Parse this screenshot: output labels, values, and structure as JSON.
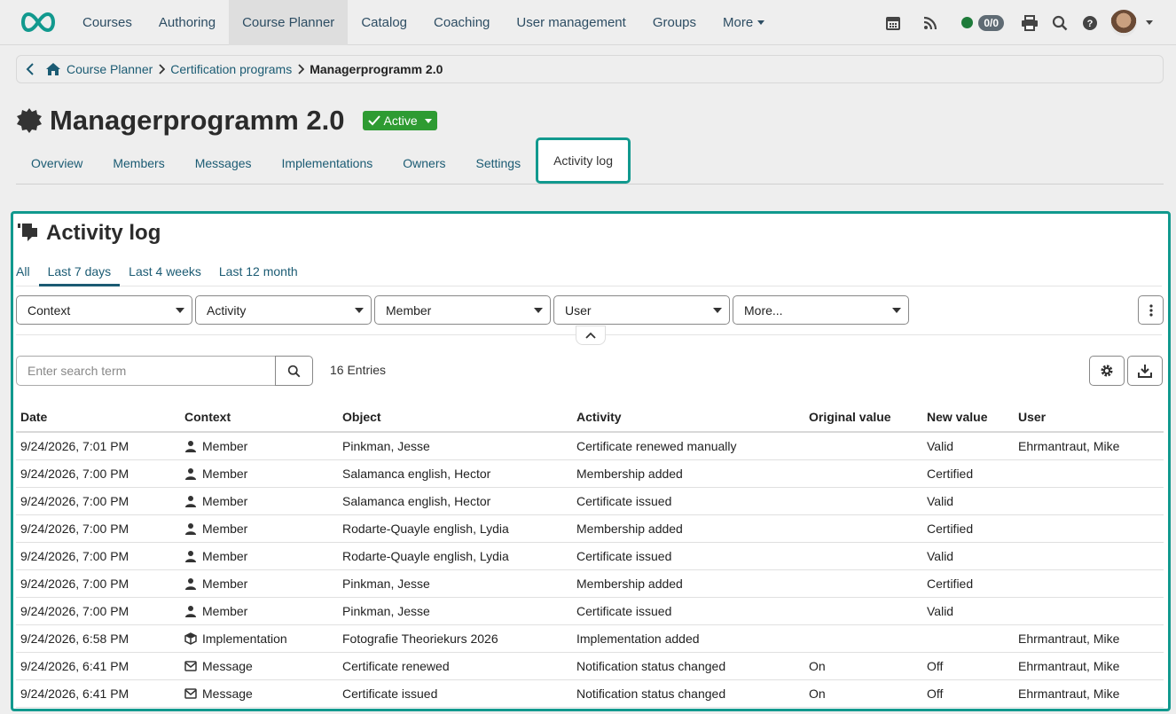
{
  "nav": {
    "items": [
      "Courses",
      "Authoring",
      "Course Planner",
      "Catalog",
      "Coaching",
      "User management",
      "Groups"
    ],
    "more": "More",
    "badge": "0/0",
    "logo_color": "#11998e"
  },
  "breadcrumb": {
    "home": "Course Planner",
    "parent": "Certification programs",
    "current": "Managerprogramm 2.0"
  },
  "page": {
    "title": "Managerprogramm 2.0",
    "status": "Active"
  },
  "tabs": [
    "Overview",
    "Members",
    "Messages",
    "Implementations",
    "Owners",
    "Settings",
    "Activity log"
  ],
  "panel": {
    "title": "Activity log",
    "subtabs": [
      "All",
      "Last 7 days",
      "Last 4 weeks",
      "Last 12 month"
    ],
    "filters": [
      "Context",
      "Activity",
      "Member",
      "User",
      "More..."
    ],
    "search_placeholder": "Enter search term",
    "entries": "16 Entries"
  },
  "table": {
    "headers": [
      "Date",
      "Context",
      "Object",
      "Activity",
      "Original value",
      "New value",
      "User"
    ],
    "rows": [
      {
        "date": "9/24/2026, 7:01 PM",
        "icon": "person-icon",
        "context": "Member",
        "object": "Pinkman, Jesse",
        "activity": "Certificate renewed manually",
        "orig": "",
        "new": "Valid",
        "user": "Ehrmantraut, Mike"
      },
      {
        "date": "9/24/2026, 7:00 PM",
        "icon": "person-icon",
        "context": "Member",
        "object": "Salamanca english, Hector",
        "activity": "Membership added",
        "orig": "",
        "new": "Certified",
        "user": ""
      },
      {
        "date": "9/24/2026, 7:00 PM",
        "icon": "person-icon",
        "context": "Member",
        "object": "Salamanca english, Hector",
        "activity": "Certificate issued",
        "orig": "",
        "new": "Valid",
        "user": ""
      },
      {
        "date": "9/24/2026, 7:00 PM",
        "icon": "person-icon",
        "context": "Member",
        "object": "Rodarte-Quayle english, Lydia",
        "activity": "Membership added",
        "orig": "",
        "new": "Certified",
        "user": ""
      },
      {
        "date": "9/24/2026, 7:00 PM",
        "icon": "person-icon",
        "context": "Member",
        "object": "Rodarte-Quayle english, Lydia",
        "activity": "Certificate issued",
        "orig": "",
        "new": "Valid",
        "user": ""
      },
      {
        "date": "9/24/2026, 7:00 PM",
        "icon": "person-icon",
        "context": "Member",
        "object": "Pinkman, Jesse",
        "activity": "Membership added",
        "orig": "",
        "new": "Certified",
        "user": ""
      },
      {
        "date": "9/24/2026, 7:00 PM",
        "icon": "person-icon",
        "context": "Member",
        "object": "Pinkman, Jesse",
        "activity": "Certificate issued",
        "orig": "",
        "new": "Valid",
        "user": ""
      },
      {
        "date": "9/24/2026, 6:58 PM",
        "icon": "cube-icon",
        "context": "Implementation",
        "object": "Fotografie Theoriekurs 2026",
        "activity": "Implementation added",
        "orig": "",
        "new": "",
        "user": "Ehrmantraut, Mike"
      },
      {
        "date": "9/24/2026, 6:41 PM",
        "icon": "envelope-icon",
        "context": "Message",
        "object": "Certificate renewed",
        "activity": "Notification status changed",
        "orig": "On",
        "new": "Off",
        "user": "Ehrmantraut, Mike"
      },
      {
        "date": "9/24/2026, 6:41 PM",
        "icon": "envelope-icon",
        "context": "Message",
        "object": "Certificate issued",
        "activity": "Notification status changed",
        "orig": "On",
        "new": "Off",
        "user": "Ehrmantraut, Mike"
      }
    ]
  }
}
